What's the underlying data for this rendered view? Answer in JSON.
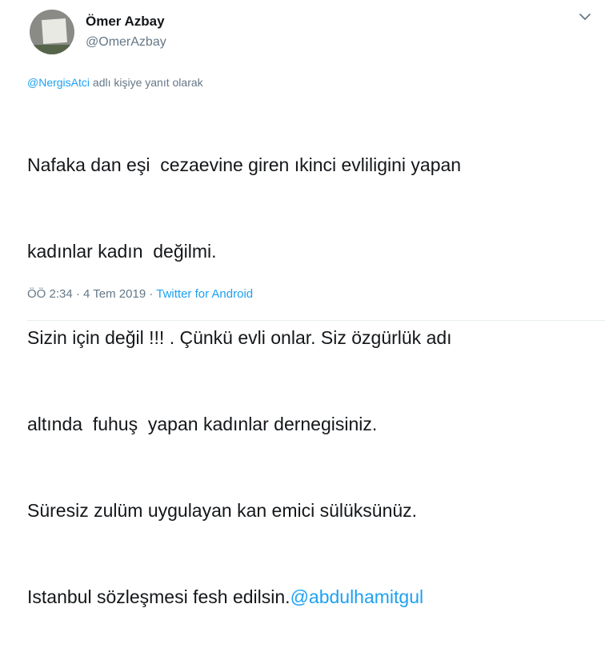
{
  "author": {
    "display_name": "Ömer Azbay",
    "handle": "@OmerAzbay"
  },
  "reply": {
    "mention": "@NergisAtci",
    "suffix": " adlı kişiye yanıt olarak"
  },
  "tweet": {
    "lines": [
      "Nafaka dan eşi  cezaevine giren ıkinci evliligini yapan",
      "kadınlar kadın  değilmi.",
      "Sizin için değil !!! . Çünkü evli onlar. Siz özgürlük adı",
      "altında  fuhuş  yapan kadınlar dernegisiniz.",
      "Süresiz zulüm uygulayan kan emici sülüksünüz."
    ],
    "last_line_text": "Istanbul sözleşmesi fesh edilsin.",
    "last_line_link": "@abdulhamitgul"
  },
  "meta": {
    "time": "ÖÖ 2:34",
    "sep1": " · ",
    "date": "4 Tem 2019",
    "sep2": " · ",
    "source": "Twitter for Android"
  },
  "colors": {
    "link": "#1da1f2",
    "secondary": "#657786",
    "text": "#14171a"
  },
  "icons": {
    "caret": "chevron-down-icon"
  }
}
